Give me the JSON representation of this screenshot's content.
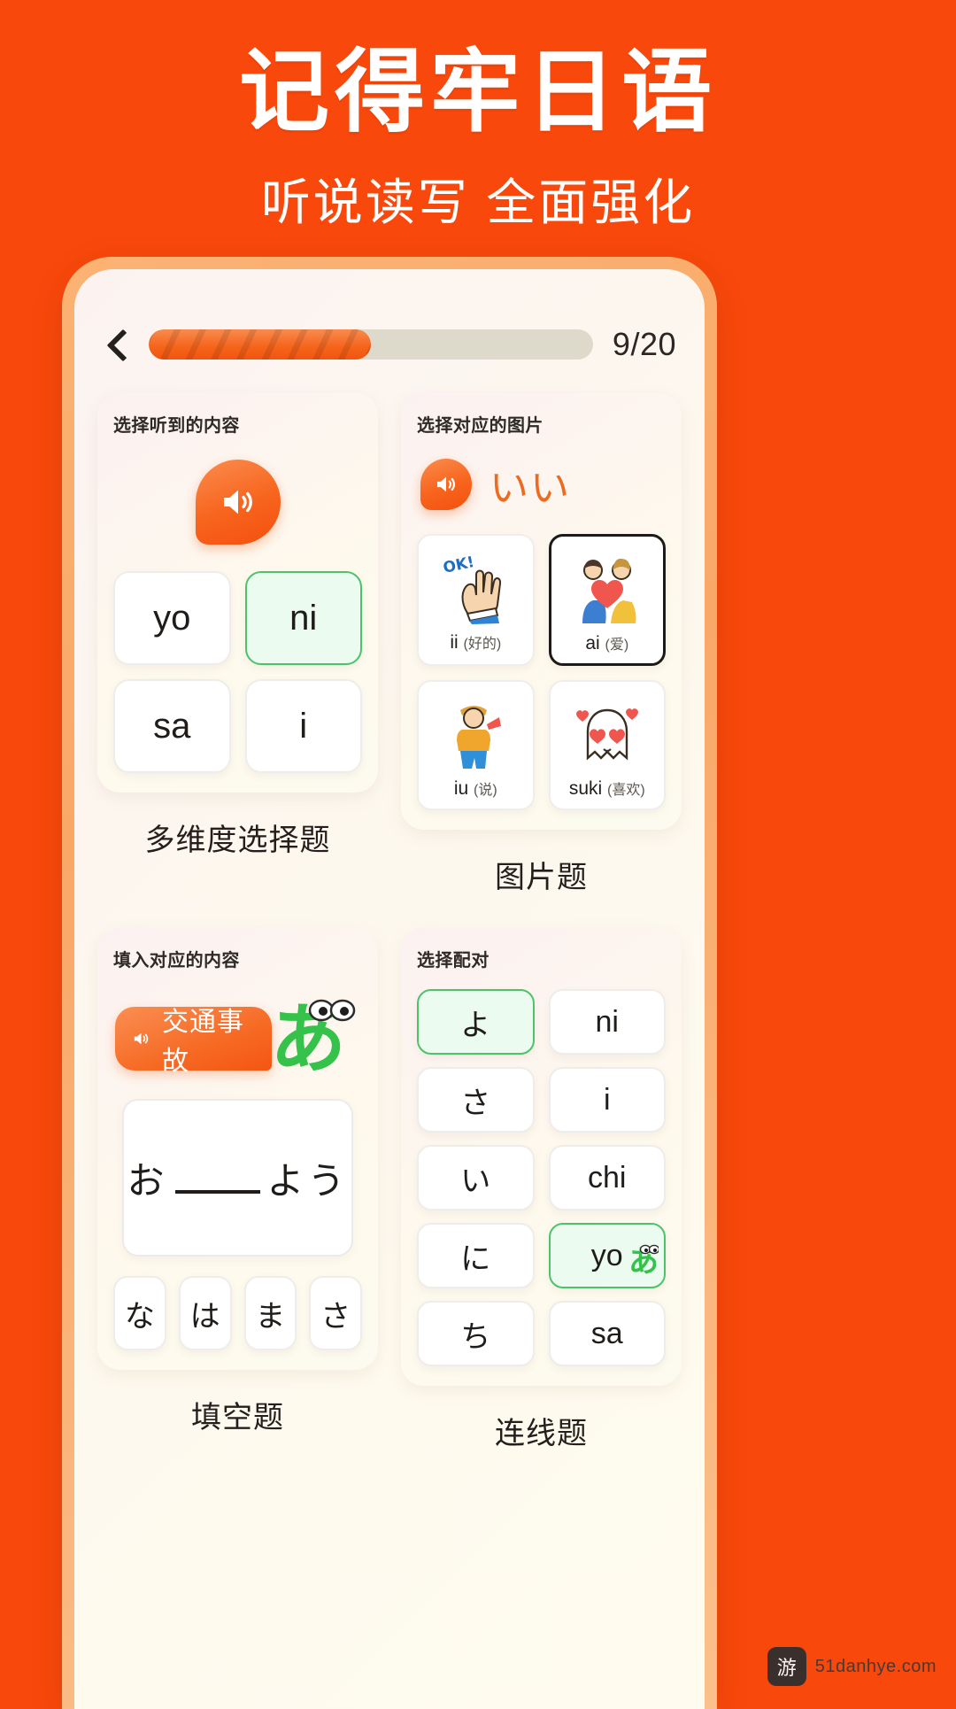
{
  "hero": {
    "title": "记得牢日语",
    "subtitle": "听说读写 全面强化"
  },
  "app": {
    "topbar": {
      "back_icon": "chevron-left-icon",
      "progress_current": 9,
      "progress_total": 20,
      "progress_percent": 50,
      "counter_label": "9/20"
    },
    "cards": [
      {
        "id": "listening-choice",
        "header": "选择听到的内容",
        "speaker_icon": "speaker-icon",
        "options": [
          {
            "label": "yo",
            "selected": false
          },
          {
            "label": "ni",
            "selected": true
          },
          {
            "label": "sa",
            "selected": false
          },
          {
            "label": "i",
            "selected": false
          }
        ],
        "caption": "多维度选择题"
      },
      {
        "id": "picture-choice",
        "header": "选择对应的图片",
        "speaker_icon": "speaker-icon",
        "prompt_word": "いい",
        "pictures": [
          {
            "romaji": "ii",
            "meaning": "(好的)",
            "art": "ok-hand-icon",
            "selected": false
          },
          {
            "romaji": "ai",
            "meaning": "(爱)",
            "art": "couple-heart-icon",
            "selected": true
          },
          {
            "romaji": "iu",
            "meaning": "(说)",
            "art": "speaking-person-icon",
            "selected": false
          },
          {
            "romaji": "suki",
            "meaning": "(喜欢)",
            "art": "ghost-hearts-icon",
            "selected": false
          }
        ],
        "caption": "图片题"
      },
      {
        "id": "fill-in-blank",
        "header": "填入对应的内容",
        "speaker_icon": "speaker-icon",
        "prompt_pill": "交通事故",
        "mascot": "green-a-mascot",
        "blank_prefix": "お",
        "blank_suffix": "よう",
        "chips": [
          "な",
          "は",
          "ま",
          "さ"
        ],
        "caption": "填空题"
      },
      {
        "id": "matching",
        "header": "选择配对",
        "left_column": [
          "よ",
          "さ",
          "い",
          "に",
          "ち"
        ],
        "right_column": [
          "ni",
          "i",
          "chi",
          "yo",
          "sa"
        ],
        "selected_left": "よ",
        "selected_right": "yo",
        "caption": "连线题"
      }
    ]
  },
  "watermark": {
    "badge": "游戏网logo",
    "text": "51danhye.com"
  },
  "colors": {
    "background": "#F9480B",
    "accent_orange": "#F4500E",
    "selected_green_bg": "#EBFBEF",
    "selected_green_border": "#4DC26B",
    "progress_track": "#DEDACB"
  }
}
